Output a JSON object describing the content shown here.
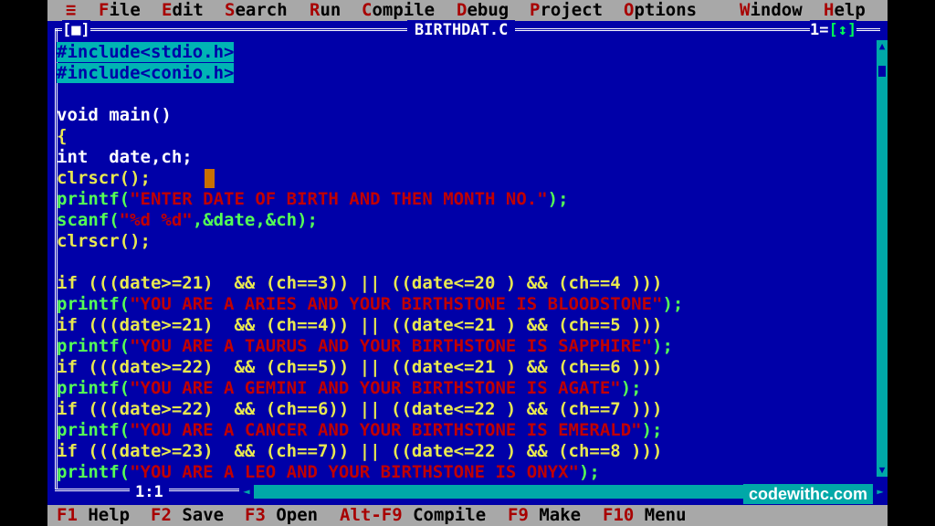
{
  "menu": {
    "sys": "≡",
    "items": [
      {
        "hot": "F",
        "rest": "ile"
      },
      {
        "hot": "E",
        "rest": "dit"
      },
      {
        "hot": "S",
        "rest": "earch"
      },
      {
        "hot": "R",
        "rest": "un"
      },
      {
        "hot": "C",
        "rest": "ompile"
      },
      {
        "hot": "D",
        "rest": "ebug"
      },
      {
        "hot": "P",
        "rest": "roject"
      },
      {
        "hot": "O",
        "rest": "ptions"
      },
      {
        "hot": "W",
        "rest": "indow"
      },
      {
        "hot": "H",
        "rest": "elp"
      }
    ]
  },
  "window": {
    "title": "BIRTHDAT.C",
    "close": "[■]",
    "number": "1",
    "zoom": "[↕]",
    "position": "1:1"
  },
  "code": {
    "lines": [
      {
        "text": "#include<stdio.h>",
        "kind": "include"
      },
      {
        "text": "#include<conio.h>",
        "kind": "include"
      },
      {
        "text": "",
        "kind": "blank"
      },
      {
        "text": "void main()",
        "kind": "white"
      },
      {
        "text": "{",
        "kind": "yellow"
      },
      {
        "text": "int  date,ch;",
        "kind": "white"
      },
      {
        "text": "clrscr();",
        "kind": "yellow"
      },
      {
        "pre": "printf(",
        "str": "\"ENTER DATE OF BIRTH AND THEN MONTH NO.\"",
        "post": ");",
        "kind": "print"
      },
      {
        "pre": "scanf(",
        "str": "\"%d %d\"",
        "post": ",&date,&ch);",
        "kind": "print"
      },
      {
        "text": "clrscr();",
        "kind": "yellow"
      },
      {
        "text": "",
        "kind": "blank"
      },
      {
        "text": "if (((date>=21)  && (ch==3)) || ((date<=20 ) && (ch==4 )))",
        "kind": "yellow"
      },
      {
        "pre": "printf(",
        "str": "\"YOU ARE A ARIES AND YOUR BIRTHSTONE IS BLOODSTONE\"",
        "post": ");",
        "kind": "print"
      },
      {
        "text": "if (((date>=21)  && (ch==4)) || ((date<=21 ) && (ch==5 )))",
        "kind": "yellow"
      },
      {
        "pre": "printf(",
        "str": "\"YOU ARE A TAURUS AND YOUR BIRTHSTONE IS SAPPHIRE\"",
        "post": ");",
        "kind": "print"
      },
      {
        "text": "if (((date>=22)  && (ch==5)) || ((date<=21 ) && (ch==6 )))",
        "kind": "yellow"
      },
      {
        "pre": "printf(",
        "str": "\"YOU ARE A GEMINI AND YOUR BIRTHSTONE IS AGATE\"",
        "post": ");",
        "kind": "print"
      },
      {
        "text": "if (((date>=22)  && (ch==6)) || ((date<=22 ) && (ch==7 )))",
        "kind": "yellow"
      },
      {
        "pre": "printf(",
        "str": "\"YOU ARE A CANCER AND YOUR BIRTHSTONE IS EMERALD\"",
        "post": ");",
        "kind": "print"
      },
      {
        "text": "if (((date>=23)  && (ch==7)) || ((date<=22 ) && (ch==8 )))",
        "kind": "yellow"
      },
      {
        "pre": "printf(",
        "str": "\"YOU ARE A LEO AND YOUR BIRTHSTONE IS ONYX\"",
        "post": ");",
        "kind": "print"
      }
    ]
  },
  "status": {
    "items": [
      {
        "key": "F1",
        "label": "Help"
      },
      {
        "key": "F2",
        "label": "Save"
      },
      {
        "key": "F3",
        "label": "Open"
      },
      {
        "key": "Alt-F9",
        "label": "Compile"
      },
      {
        "key": "F9",
        "label": "Make"
      },
      {
        "key": "F10",
        "label": "Menu"
      }
    ]
  },
  "watermark": "codewithc.com",
  "colors": {
    "background": "#0000a8",
    "menubar": "#a8a8a8",
    "hotkey": "#a80000",
    "string": "#c00000",
    "keyword": "#e8e850",
    "highlight": "#00a8a8"
  }
}
